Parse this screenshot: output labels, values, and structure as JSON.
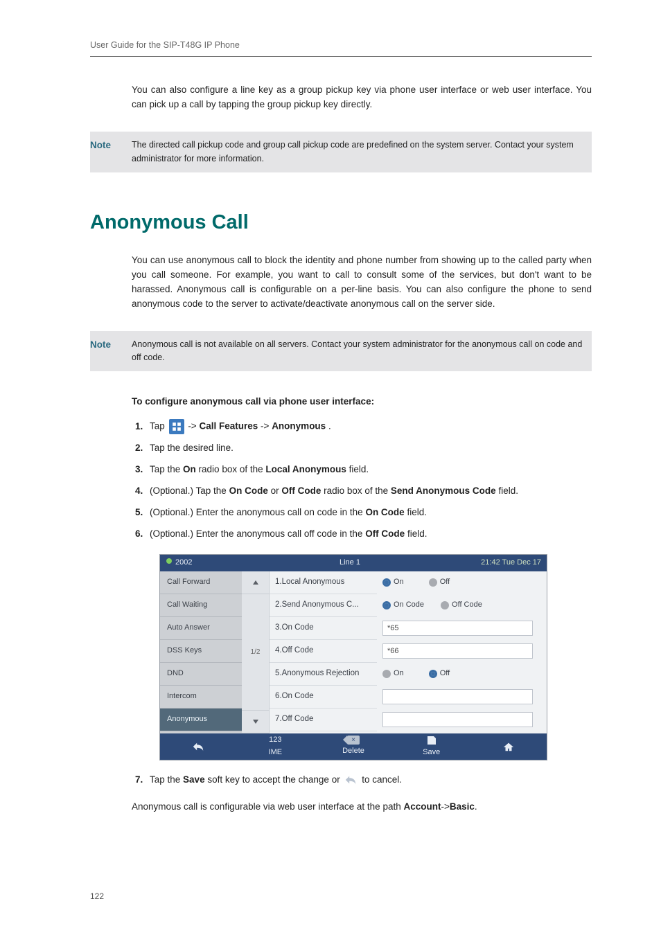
{
  "header": {
    "title": "User Guide for the SIP-T48G IP Phone"
  },
  "intro": {
    "p1": "You can also configure a line key as a group pickup key via phone user interface or web user interface. You can pick up a call by tapping the group pickup key directly."
  },
  "note1": {
    "label": "Note",
    "body": "The directed call pickup code and group call pickup code are predefined on the system server. Contact your system administrator for more information."
  },
  "section": {
    "title": "Anonymous Call"
  },
  "anon_intro": "You can use anonymous call to block the identity and phone number from showing up to the called party when you call someone. For example, you want to call to consult some of the services, but don't want to be harassed. Anonymous call is configurable on a per-line basis. You can also configure the phone to send anonymous code to the server to activate/deactivate anonymous call on the server side.",
  "note2": {
    "label": "Note",
    "body": "Anonymous call is not available on all servers. Contact your system administrator for the anonymous call on code and off code."
  },
  "instr_head": "To configure anonymous call via phone user interface:",
  "steps": {
    "s1_a": "Tap",
    "s1_b": "->",
    "s1_c": "Call Features",
    "s1_d": "->",
    "s1_e": "Anonymous",
    "s1_f": ".",
    "s2": "Tap the desired line.",
    "s3_a": "Tap the ",
    "s3_b": "On",
    "s3_c": " radio box of the ",
    "s3_d": "Local Anonymous",
    "s3_e": " field.",
    "s4_a": "(Optional.) Tap the ",
    "s4_b": "On Code",
    "s4_c": " or ",
    "s4_d": "Off Code",
    "s4_e": " radio box of the ",
    "s4_f": "Send Anonymous Code",
    "s4_g": " field.",
    "s5_a": "(Optional.) Enter the anonymous call on code in the ",
    "s5_b": "On Code",
    "s5_c": " field.",
    "s6_a": "(Optional.) Enter the anonymous call off code in the ",
    "s6_b": "Off Code",
    "s6_c": " field."
  },
  "phone": {
    "hdr": {
      "ext": "2002",
      "title": "Line 1",
      "time": "21:42 Tue Dec 17"
    },
    "side": [
      "Call Forward",
      "Call Waiting",
      "Auto Answer",
      "DSS Keys",
      "DND",
      "Intercom",
      "Anonymous"
    ],
    "scroll_mid": "1/2",
    "labels": [
      "1.Local Anonymous",
      "2.Send Anonymous C...",
      "3.On Code",
      "4.Off Code",
      "5.Anonymous Rejection",
      "6.On Code",
      "7.Off Code"
    ],
    "row1": {
      "on": "On",
      "off": "Off"
    },
    "row2": {
      "on": "On Code",
      "off": "Off Code"
    },
    "row3": {
      "val": "*65"
    },
    "row4": {
      "val": "*66"
    },
    "row5": {
      "on": "On",
      "off": "Off"
    },
    "row6": {
      "val": ""
    },
    "row7": {
      "val": ""
    },
    "footer": {
      "ime1": "123",
      "ime2": "IME",
      "del": "Delete",
      "save": "Save",
      "x": "×"
    }
  },
  "step7": {
    "a": "Tap the ",
    "b": "Save",
    "c": " soft key to accept the change or ",
    "d": " to cancel."
  },
  "outro": {
    "a": "Anonymous call is configurable via web user interface at the path ",
    "b": "Account",
    "c": "->",
    "d": "Basic",
    "e": "."
  },
  "page_number": "122"
}
